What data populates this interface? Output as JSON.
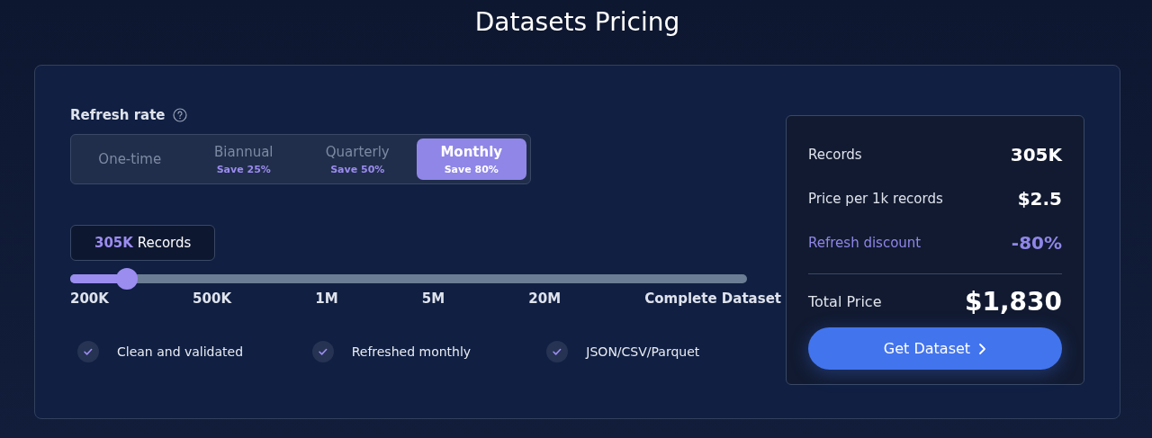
{
  "title": "Datasets Pricing",
  "refresh_rate": {
    "label": "Refresh rate",
    "options": [
      {
        "label": "One-time",
        "selected": false
      },
      {
        "label": "Biannual",
        "saving": "Save 25%",
        "selected": false
      },
      {
        "label": "Quarterly",
        "saving": "Save 50%",
        "selected": false
      },
      {
        "label": "Monthly",
        "saving": "Save 80%",
        "selected": true
      }
    ]
  },
  "records_badge": "**305K** Records",
  "slider": {
    "level": 0.084,
    "ticks": [
      "200K",
      "500K",
      "1M",
      "5M",
      "20M",
      "Complete Dataset"
    ]
  },
  "features": [
    "Clean and validated",
    "Refreshed monthly",
    "JSON/CSV/Parquet"
  ],
  "summary": {
    "rows": [
      {
        "label": "Records",
        "value": "305K",
        "kind": "normal"
      },
      {
        "label": "Price per 1k records",
        "value": "$2.5",
        "kind": "normal"
      },
      {
        "label": "Refresh discount",
        "value": "-80%",
        "kind": "discount"
      }
    ],
    "total_label": "Total Price",
    "total_value": "$1,830",
    "button": "Get Dataset"
  }
}
